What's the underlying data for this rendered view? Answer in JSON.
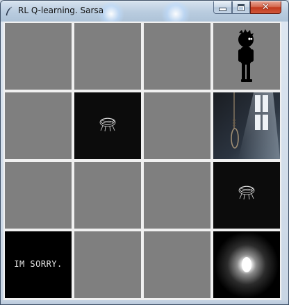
{
  "window": {
    "title": "RL Q-learning. Sarsa",
    "controls": [
      "minimize",
      "maximize",
      "close"
    ]
  },
  "grid": {
    "rows": 4,
    "cols": 4,
    "empty_cell_color": "#808080",
    "cells": [
      {
        "row": 0,
        "col": 3,
        "content": "agent-boy"
      },
      {
        "row": 1,
        "col": 1,
        "content": "spider-trap"
      },
      {
        "row": 1,
        "col": 3,
        "content": "noose-trap"
      },
      {
        "row": 2,
        "col": 3,
        "content": "spider-trap"
      },
      {
        "row": 3,
        "col": 0,
        "content": "sorry-tile",
        "text": "IM SORRY."
      },
      {
        "row": 3,
        "col": 3,
        "content": "light-goal"
      }
    ]
  }
}
